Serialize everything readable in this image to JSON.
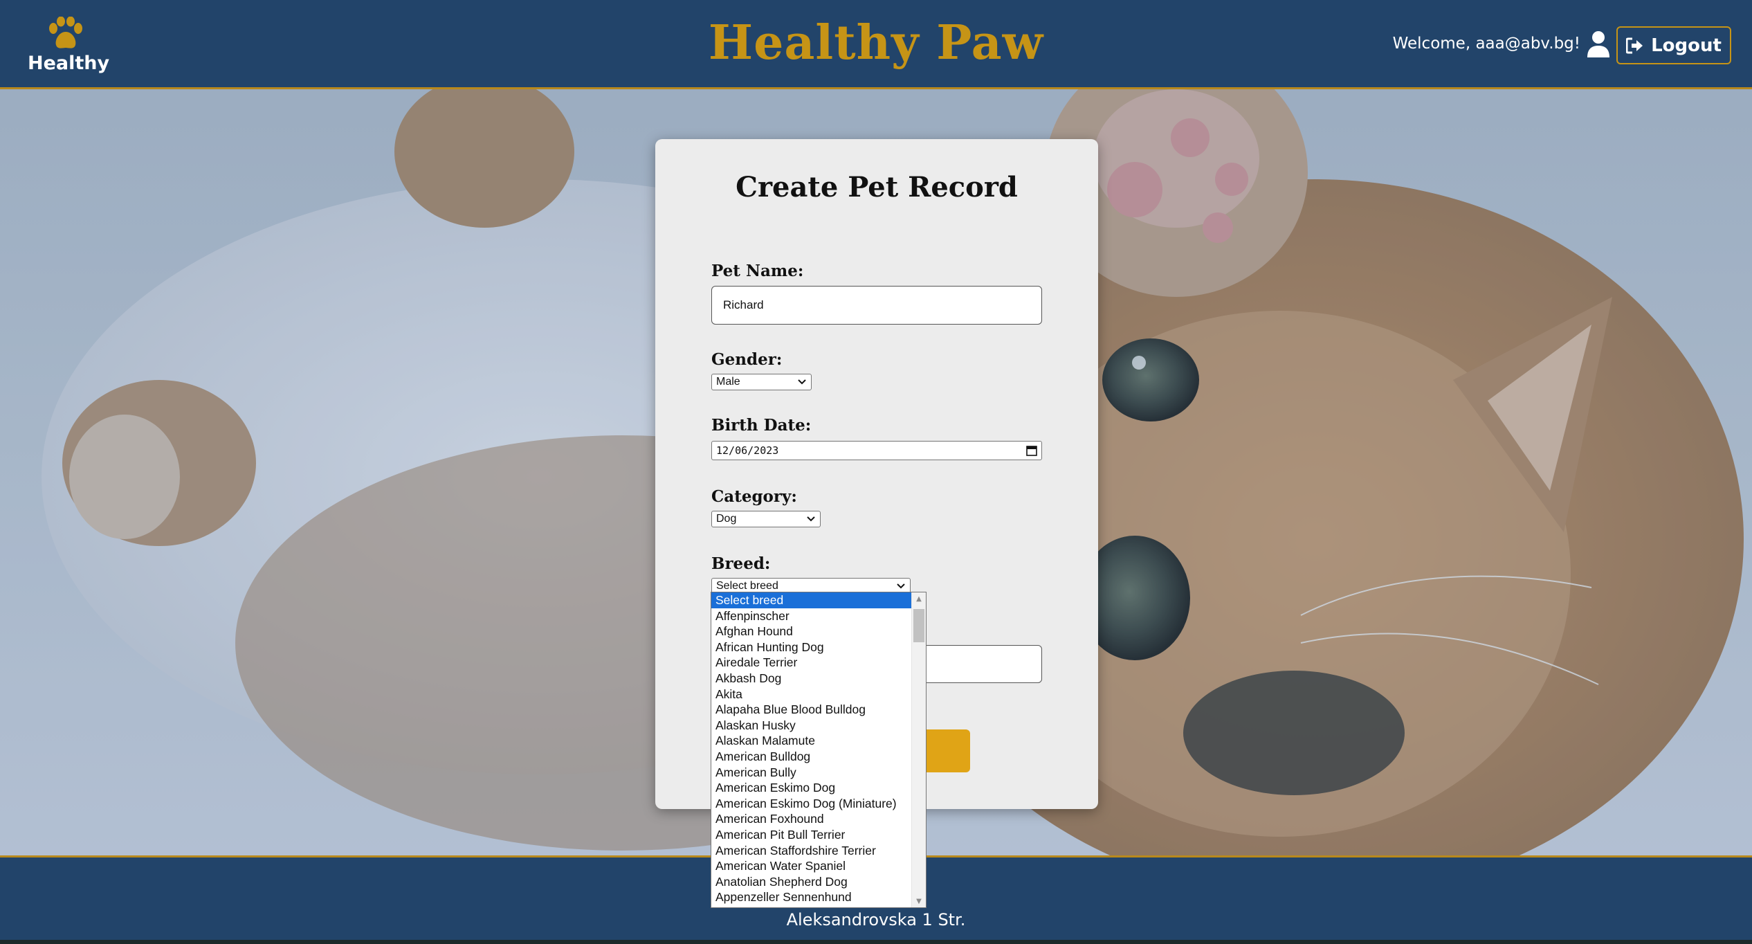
{
  "header": {
    "logo_text": "Healthy",
    "brand_title": "Healthy Paw",
    "welcome_text": "Welcome, aaa@abv.bg!",
    "logout_label": "Logout"
  },
  "form": {
    "title": "Create Pet Record",
    "pet_name": {
      "label": "Pet Name:",
      "value": "Richard"
    },
    "gender": {
      "label": "Gender:",
      "value": "Male"
    },
    "birth_date": {
      "label": "Birth Date:",
      "value": "12/06/2023"
    },
    "category": {
      "label": "Category:",
      "value": "Dog"
    },
    "breed": {
      "label": "Breed:",
      "value": "Select breed",
      "options": [
        "Select breed",
        "Affenpinscher",
        "Afghan Hound",
        "African Hunting Dog",
        "Airedale Terrier",
        "Akbash Dog",
        "Akita",
        "Alapaha Blue Blood Bulldog",
        "Alaskan Husky",
        "Alaskan Malamute",
        "American Bulldog",
        "American Bully",
        "American Eskimo Dog",
        "American Eskimo Dog (Miniature)",
        "American Foxhound",
        "American Pit Bull Terrier",
        "American Staffordshire Terrier",
        "American Water Spaniel",
        "Anatolian Shepherd Dog",
        "Appenzeller Sennenhund"
      ]
    }
  },
  "footer": {
    "address": "Aleksandrovska 1 Str."
  },
  "colors": {
    "navy": "#22446a",
    "gold": "#c69416",
    "button_gold": "#e0a416",
    "selected_option": "#1a6fd8"
  }
}
